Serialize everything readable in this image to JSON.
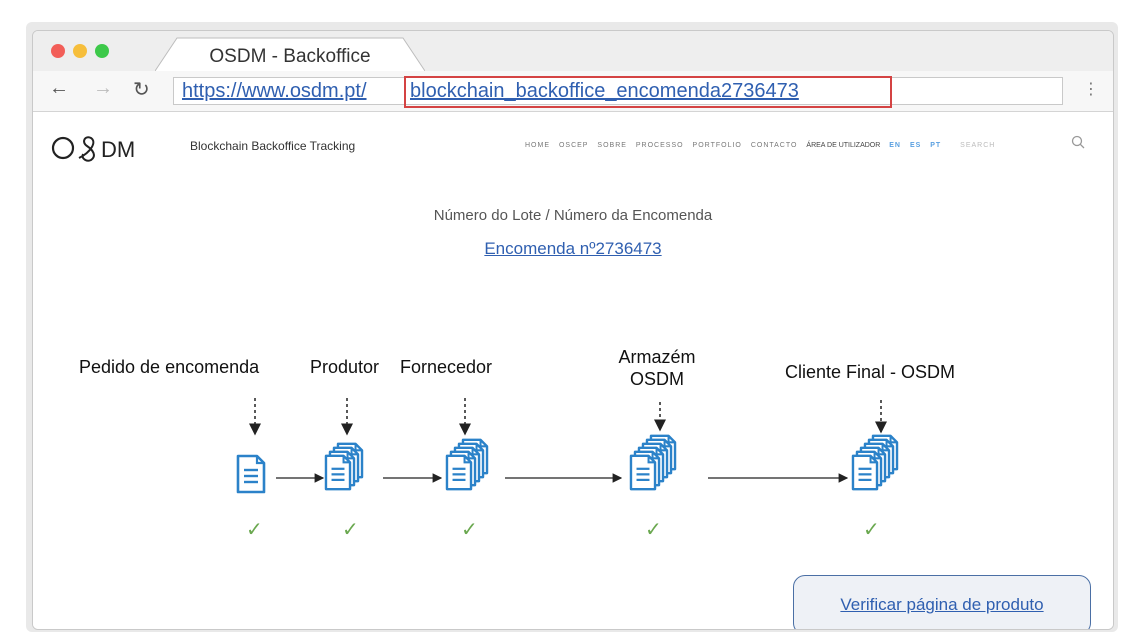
{
  "browser": {
    "tab_title": "OSDM - Backoffice",
    "url_prefix": "https://www.osdm.pt/",
    "url_path": "blockchain_backoffice_encomenda2736473",
    "back_icon": "arrow-left-icon",
    "forward_icon": "arrow-right-icon",
    "reload_icon": "reload-icon",
    "menu_icon": "vertical-dots-icon"
  },
  "site": {
    "logo_text": "O&DM",
    "subtitle": "Blockchain Backoffice Tracking",
    "menu": [
      "HOME",
      "OSCEP",
      "SOBRE",
      "PROCESSO",
      "PORTFOLIO",
      "CONTACTO"
    ],
    "user_area": "ÁREA DE UTILIZADOR",
    "languages": [
      "EN",
      "ES",
      "PT"
    ],
    "search_placeholder": "SEARCH"
  },
  "main": {
    "lot_label": "Número do Lote / Número da Encomenda",
    "order_link": "Encomenda nº2736473",
    "stages": [
      {
        "label": "Pedido de encomenda",
        "verified": true
      },
      {
        "label": "Produtor",
        "verified": true
      },
      {
        "label": "Fornecedor",
        "verified": true
      },
      {
        "label_line1": "Armazém",
        "label_line2": "OSDM",
        "verified": true
      },
      {
        "label": "Cliente Final - OSDM",
        "verified": true
      }
    ],
    "check_glyph": "✓",
    "verify_button": "Verificar página de produto"
  },
  "colors": {
    "link": "#2f5fb0",
    "doc_icon": "#2b82c9",
    "check": "#6aa84f",
    "highlight": "#d44343"
  }
}
